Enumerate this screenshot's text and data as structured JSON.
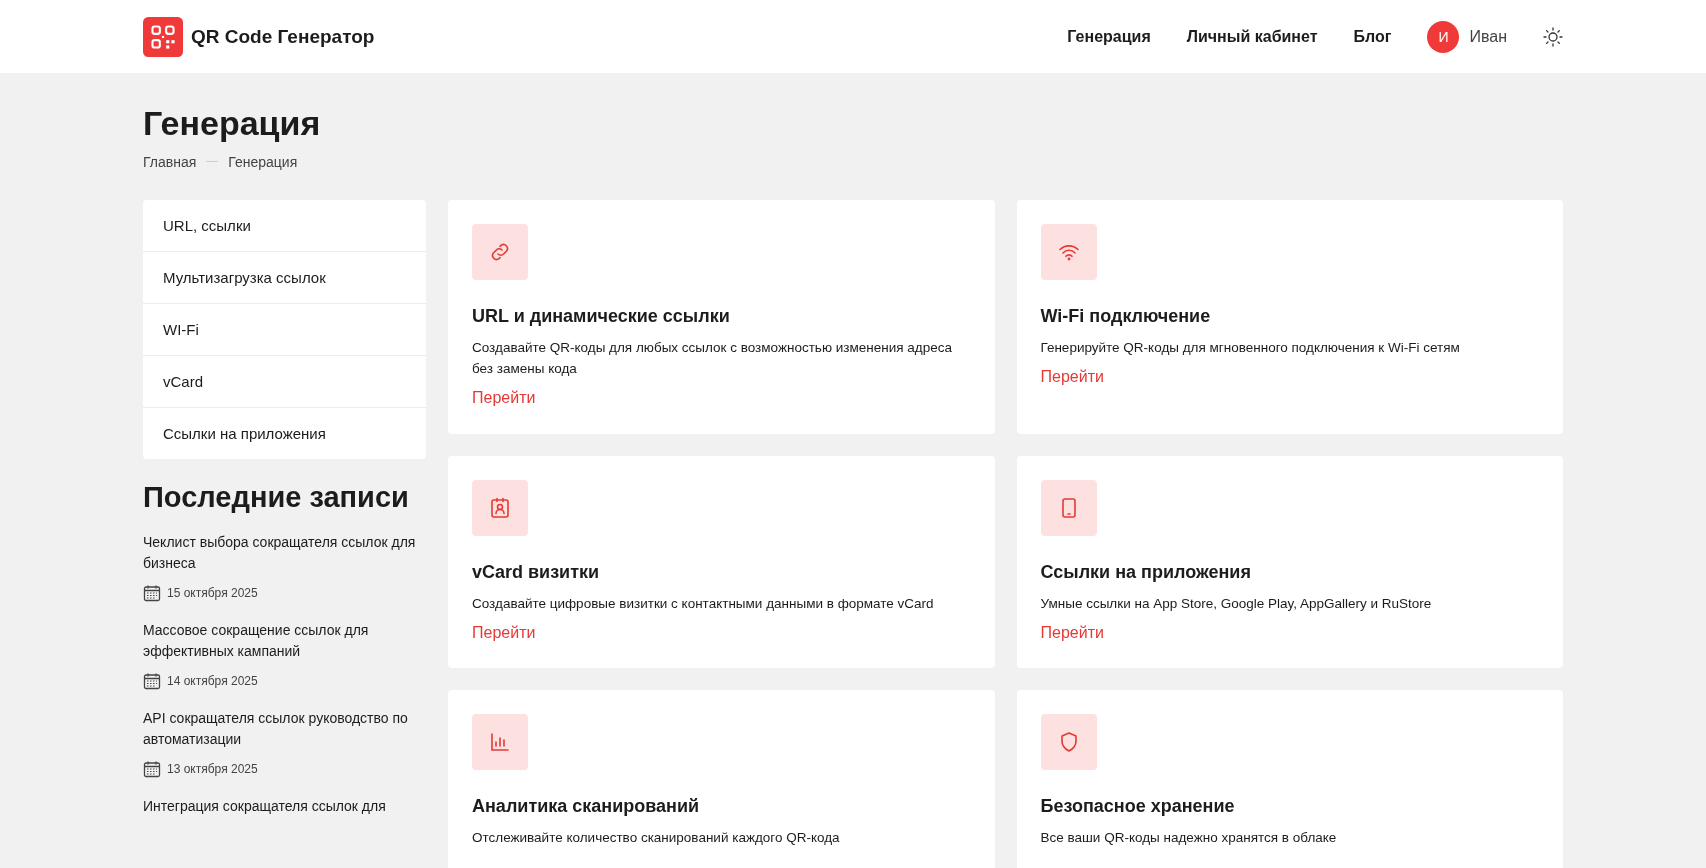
{
  "header": {
    "logo_text": "QR Code Генератор",
    "nav": [
      {
        "label": "Генерация"
      },
      {
        "label": "Личный кабинет"
      },
      {
        "label": "Блог"
      }
    ],
    "user": {
      "initial": "И",
      "name": "Иван"
    }
  },
  "page": {
    "title": "Генерация",
    "breadcrumbs": [
      "Главная",
      "Генерация"
    ]
  },
  "sidebar": {
    "menu": [
      {
        "label": "URL, ссылки"
      },
      {
        "label": "Мультизагрузка ссылок"
      },
      {
        "label": "WI-Fi"
      },
      {
        "label": "vCard"
      },
      {
        "label": "Ссылки на приложения"
      }
    ],
    "recent_title": "Последние записи",
    "posts": [
      {
        "title": "Чеклист выбора сокращателя ссылок для бизнеса",
        "date": "15 октября 2025"
      },
      {
        "title": "Массовое сокращение ссылок для эффективных кампаний",
        "date": "14 октября 2025"
      },
      {
        "title": "API сокращателя ссылок руководство по автоматизации",
        "date": "13 октября 2025"
      },
      {
        "title": "Интеграция сокращателя ссылок для"
      }
    ]
  },
  "cards": [
    {
      "kind": "link",
      "title": "URL и динамические ссылки",
      "description": "Создавайте QR-коды для любых ссылок с возможностью изменения адреса без замены кода",
      "link": "Перейти"
    },
    {
      "kind": "wifi",
      "title": "Wi-Fi подключение",
      "description": "Генерируйте QR-коды для мгновенного подключения к Wi-Fi сетям",
      "link": "Перейти"
    },
    {
      "kind": "contact",
      "title": "vCard визитки",
      "description": "Создавайте цифровые визитки с контактными данными в формате vCard",
      "link": "Перейти"
    },
    {
      "kind": "tablet",
      "title": "Ссылки на приложения",
      "description": "Умные ссылки на App Store, Google Play, AppGallery и RuStore",
      "link": "Перейти"
    },
    {
      "kind": "chart",
      "title": "Аналитика сканирований",
      "description": "Отслеживайте количество сканирований каждого QR-кода"
    },
    {
      "kind": "shield",
      "title": "Безопасное хранение",
      "description": "Все ваши QR-коды надежно хранятся в облаке"
    }
  ]
}
